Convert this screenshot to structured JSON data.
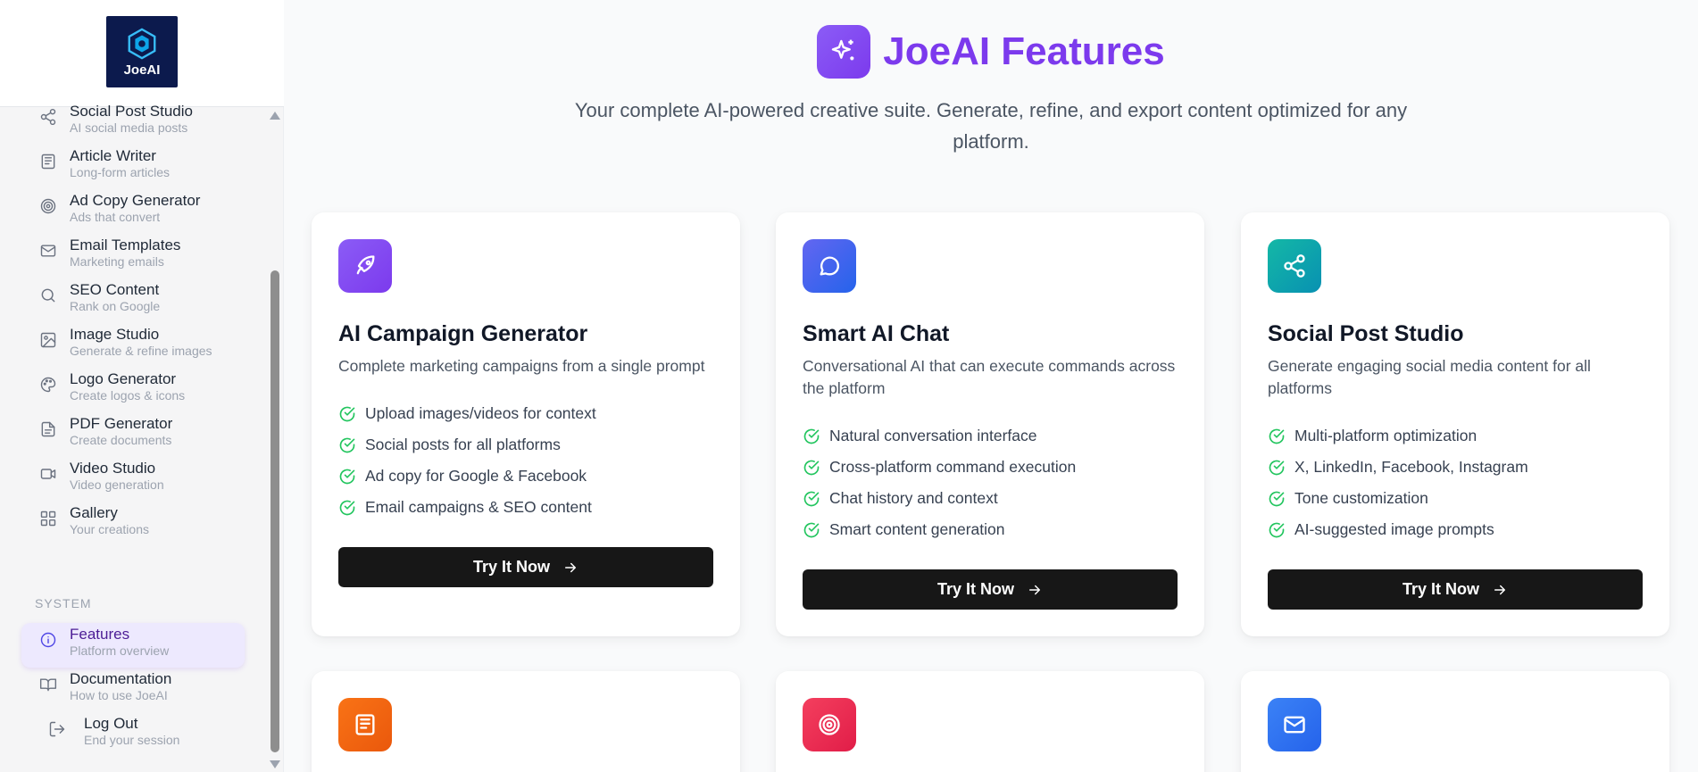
{
  "app": {
    "logo_text": "JoeAI"
  },
  "sidebar": {
    "items": [
      {
        "label": "Social Post Studio",
        "sub": "AI social media posts",
        "icon": "share-icon"
      },
      {
        "label": "Article Writer",
        "sub": "Long-form articles",
        "icon": "newspaper-icon"
      },
      {
        "label": "Ad Copy Generator",
        "sub": "Ads that convert",
        "icon": "target-icon"
      },
      {
        "label": "Email Templates",
        "sub": "Marketing emails",
        "icon": "mail-icon"
      },
      {
        "label": "SEO Content",
        "sub": "Rank on Google",
        "icon": "search-icon"
      },
      {
        "label": "Image Studio",
        "sub": "Generate & refine images",
        "icon": "image-icon"
      },
      {
        "label": "Logo Generator",
        "sub": "Create logos & icons",
        "icon": "palette-icon"
      },
      {
        "label": "PDF Generator",
        "sub": "Create documents",
        "icon": "file-icon"
      },
      {
        "label": "Video Studio",
        "sub": "Video generation",
        "icon": "video-icon"
      },
      {
        "label": "Gallery",
        "sub": "Your creations",
        "icon": "grid-icon"
      }
    ],
    "system_heading": "SYSTEM",
    "system_items": [
      {
        "label": "Features",
        "sub": "Platform overview",
        "icon": "info-icon",
        "active": true
      },
      {
        "label": "Documentation",
        "sub": "How to use JoeAI",
        "icon": "book-icon"
      },
      {
        "label": "Log Out",
        "sub": "End your session",
        "icon": "logout-icon"
      }
    ]
  },
  "header": {
    "title": "JoeAI Features",
    "subtitle": "Your complete AI-powered creative suite. Generate, refine, and export content optimized for any platform."
  },
  "cards": [
    {
      "title": "AI Campaign Generator",
      "desc": "Complete marketing campaigns from a single prompt",
      "features": [
        "Upload images/videos for context",
        "Social posts for all platforms",
        "Ad copy for Google & Facebook",
        "Email campaigns & SEO content"
      ],
      "button": "Try It Now",
      "icon": "rocket-icon",
      "color": "#7c3aed"
    },
    {
      "title": "Smart AI Chat",
      "desc": "Conversational AI that can execute commands across the platform",
      "features": [
        "Natural conversation interface",
        "Cross-platform command execution",
        "Chat history and context",
        "Smart content generation"
      ],
      "button": "Try It Now",
      "icon": "chat-icon",
      "color": "#4f46e5"
    },
    {
      "title": "Social Post Studio",
      "desc": "Generate engaging social media content for all platforms",
      "features": [
        "Multi-platform optimization",
        "X, LinkedIn, Facebook, Instagram",
        "Tone customization",
        "AI-suggested image prompts"
      ],
      "button": "Try It Now",
      "icon": "share-icon",
      "color": "#0d9488"
    }
  ],
  "bottom_cards": [
    {
      "icon": "newspaper-icon",
      "color": "#ea580c"
    },
    {
      "icon": "target-icon",
      "color": "#e11d48"
    },
    {
      "icon": "mail-icon",
      "color": "#2563eb"
    }
  ]
}
